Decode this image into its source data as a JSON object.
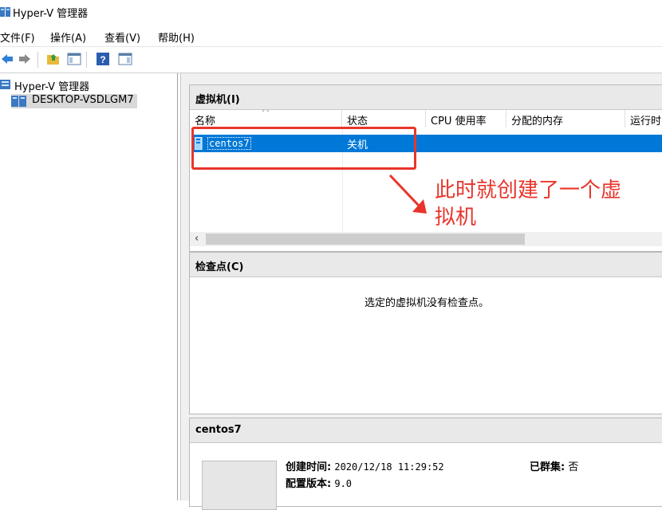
{
  "window": {
    "title": "Hyper-V 管理器"
  },
  "menu": {
    "items": [
      {
        "label": "文件(F)"
      },
      {
        "label": "操作(A)"
      },
      {
        "label": "查看(V)"
      },
      {
        "label": "帮助(H)"
      }
    ]
  },
  "toolbar": {
    "icons": [
      "back-arrow-icon",
      "forward-arrow-icon",
      "folder-up-icon",
      "show-hide-console-tree-icon",
      "help-icon",
      "show-hide-action-pane-icon"
    ]
  },
  "tree": {
    "root": "Hyper-V 管理器",
    "server": "DESKTOP-VSDLGM7"
  },
  "vm_panel": {
    "header": "虚拟机(I)",
    "columns": [
      "名称",
      "状态",
      "CPU 使用率",
      "分配的内存",
      "运行时"
    ],
    "rows": [
      {
        "name": "centos7",
        "state": "关机"
      }
    ],
    "scroll_left": "‹"
  },
  "annotation": {
    "line1": "此时就创建了一个虚",
    "line2": "拟机",
    "color": "#e8352b"
  },
  "checkpoint_panel": {
    "header": "检查点(C)",
    "empty_text": "选定的虚拟机没有检查点。"
  },
  "detail_panel": {
    "header": "centos7",
    "created_label": "创建时间:",
    "created_value": "2020/12/18 11:29:52",
    "clustered_label": "已群集:",
    "clustered_value": "否",
    "config_label": "配置版本:",
    "config_value": "9.0"
  },
  "colors": {
    "selection": "#0078d7",
    "accent_red": "#e8352b"
  }
}
